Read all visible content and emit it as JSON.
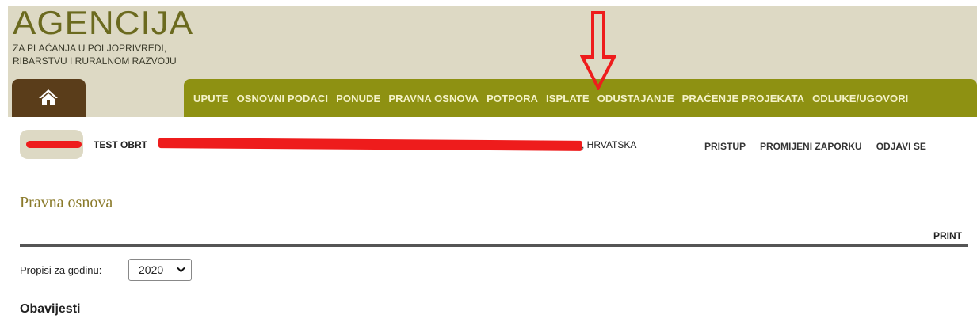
{
  "brand": {
    "title": "AGENCIJA",
    "subtitle_line1": "ZA PLAĆANJA U POLJOPRIVREDI,",
    "subtitle_line2": "RIBARSTVU I RURALNOM RAZVOJU"
  },
  "nav": {
    "home_icon": "home-icon",
    "items": [
      {
        "label": "UPUTE"
      },
      {
        "label": "OSNOVNI PODACI"
      },
      {
        "label": "PONUDE"
      },
      {
        "label": "PRAVNA OSNOVA"
      },
      {
        "label": "POTPORA"
      },
      {
        "label": "ISPLATE"
      },
      {
        "label": "ODUSTAJANJE"
      },
      {
        "label": "PRAĆENJE PROJEKATA"
      },
      {
        "label": "ODLUKE/UGOVORI"
      }
    ]
  },
  "user": {
    "name": "TEST OBRT",
    "country": ", HRVATSKA"
  },
  "account": {
    "access": "PRISTUP",
    "change_password": "PROMIJENI ZAPORKU",
    "logout": "ODJAVI SE"
  },
  "page": {
    "title": "Pravna osnova",
    "print": "PRINT"
  },
  "filter": {
    "label": "Propisi za godinu:",
    "year": "2020"
  },
  "section": {
    "title": "Obavijesti"
  },
  "colors": {
    "header_bg": "#ddd9c4",
    "nav_bg": "#8e9112",
    "home_tab_bg": "#5a3d1a",
    "accent_title": "#8a7a2a",
    "redaction": "#ee1c1c"
  }
}
